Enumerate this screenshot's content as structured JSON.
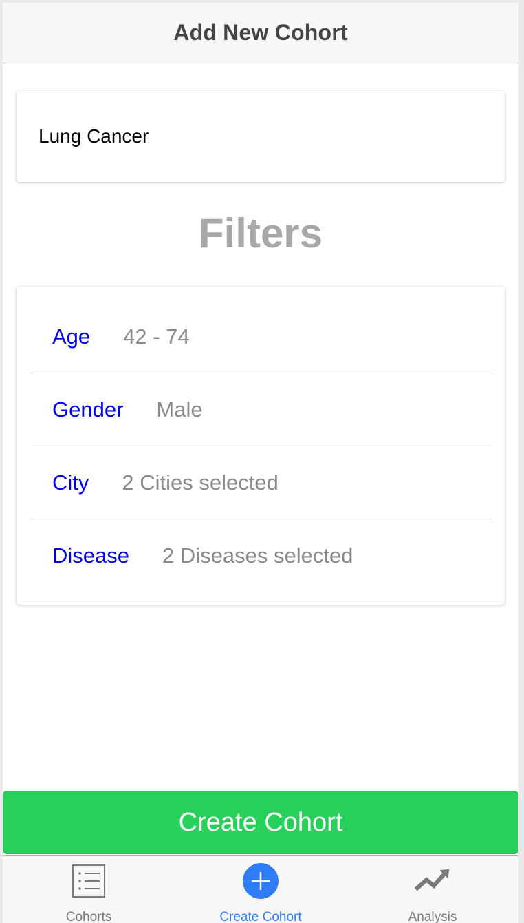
{
  "navbar": {
    "title": "Add New Cohort"
  },
  "cohort_name": {
    "value": "Lung Cancer"
  },
  "filters": {
    "heading": "Filters",
    "rows": [
      {
        "label": "Age",
        "value": "42 - 74"
      },
      {
        "label": "Gender",
        "value": "Male"
      },
      {
        "label": "City",
        "value": "2 Cities selected"
      },
      {
        "label": "Disease",
        "value": "2 Diseases selected"
      }
    ]
  },
  "create_button": {
    "label": "Create Cohort"
  },
  "tabbar": {
    "tabs": [
      {
        "label": "Cohorts",
        "icon": "list-icon",
        "active": false
      },
      {
        "label": "Create Cohort",
        "icon": "plus-circle-icon",
        "active": true
      },
      {
        "label": "Analysis",
        "icon": "trending-up-icon",
        "active": false
      }
    ]
  },
  "colors": {
    "accent": "#2e7cf6",
    "button_green": "#28d05a",
    "filter_label": "#0000ee",
    "filter_value": "#8a8a8a"
  }
}
